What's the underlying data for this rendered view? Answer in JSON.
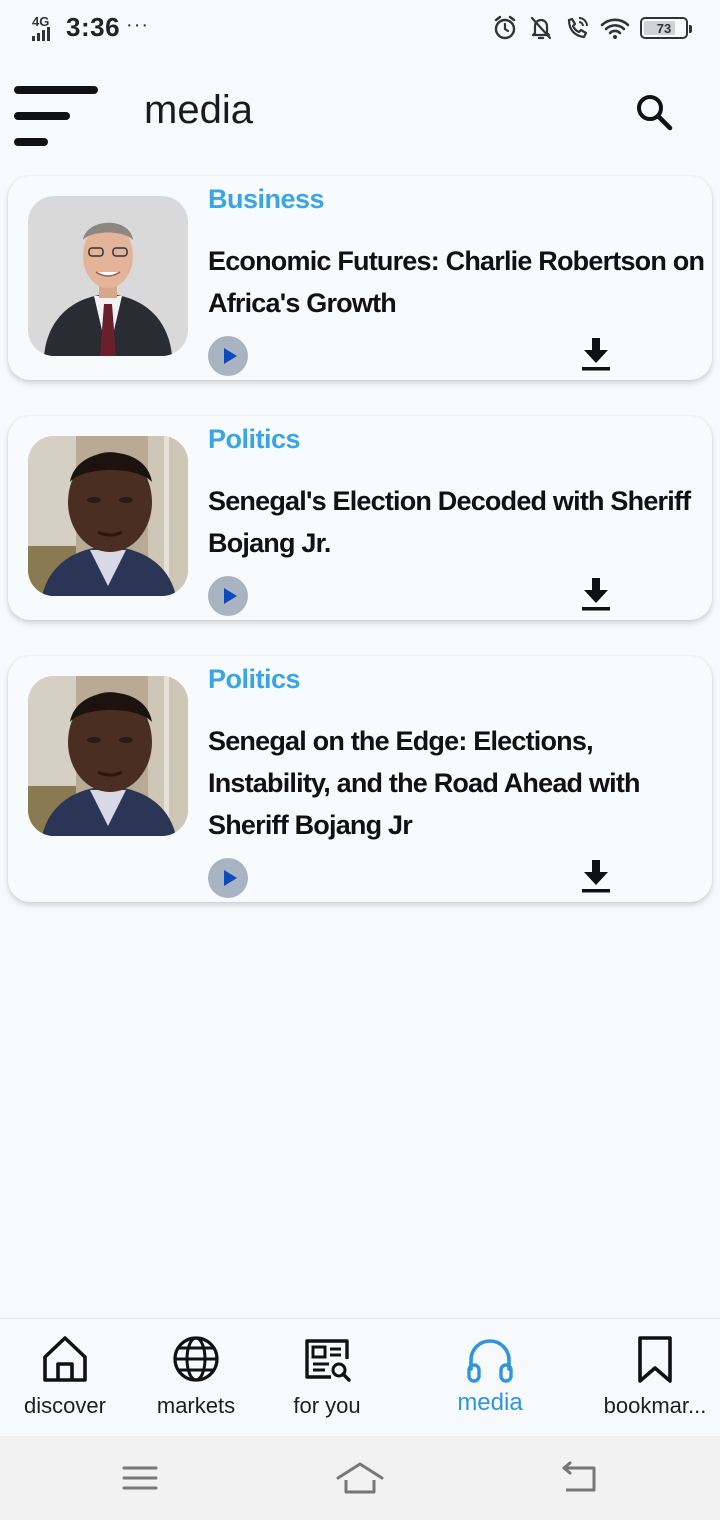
{
  "status_bar": {
    "network": "4G",
    "time": "3:36",
    "dots": "···",
    "battery": "73",
    "icons": [
      "alarm-icon",
      "notifications-off-icon",
      "wifi-calling-icon",
      "wifi-icon",
      "battery-icon"
    ]
  },
  "header": {
    "title": "media",
    "menu_icon": "menu-icon",
    "search_icon": "search-icon"
  },
  "cards": [
    {
      "category": "Business",
      "title": "Economic Futures: Charlie Robertson on Africa's Growth",
      "play_icon": "play-icon",
      "download_icon": "download-icon"
    },
    {
      "category": "Politics",
      "title": "Senegal's Election Decoded with Sheriff Bojang Jr.",
      "play_icon": "play-icon",
      "download_icon": "download-icon"
    },
    {
      "category": "Politics",
      "title": "Senegal on the Edge: Elections, Instability, and the Road Ahead with Sheriff Bojang Jr",
      "play_icon": "play-icon",
      "download_icon": "download-icon"
    }
  ],
  "bottom_nav": {
    "items": [
      {
        "label": "discover",
        "icon": "home-icon",
        "active": false
      },
      {
        "label": "markets",
        "icon": "globe-icon",
        "active": false
      },
      {
        "label": "for you",
        "icon": "news-search-icon",
        "active": false
      },
      {
        "label": "media",
        "icon": "headphones-icon",
        "active": true
      },
      {
        "label": "bookmar...",
        "icon": "bookmark-icon",
        "active": false
      }
    ]
  },
  "system_nav": {
    "buttons": [
      "recents-menu-icon",
      "home-icon",
      "back-icon"
    ]
  },
  "colors": {
    "background": "#f6fafd",
    "category": "#39a5e6",
    "active_nav": "#2f96dc",
    "play_button": "#a9b3c2",
    "play_triangle": "#0c4cb7"
  }
}
